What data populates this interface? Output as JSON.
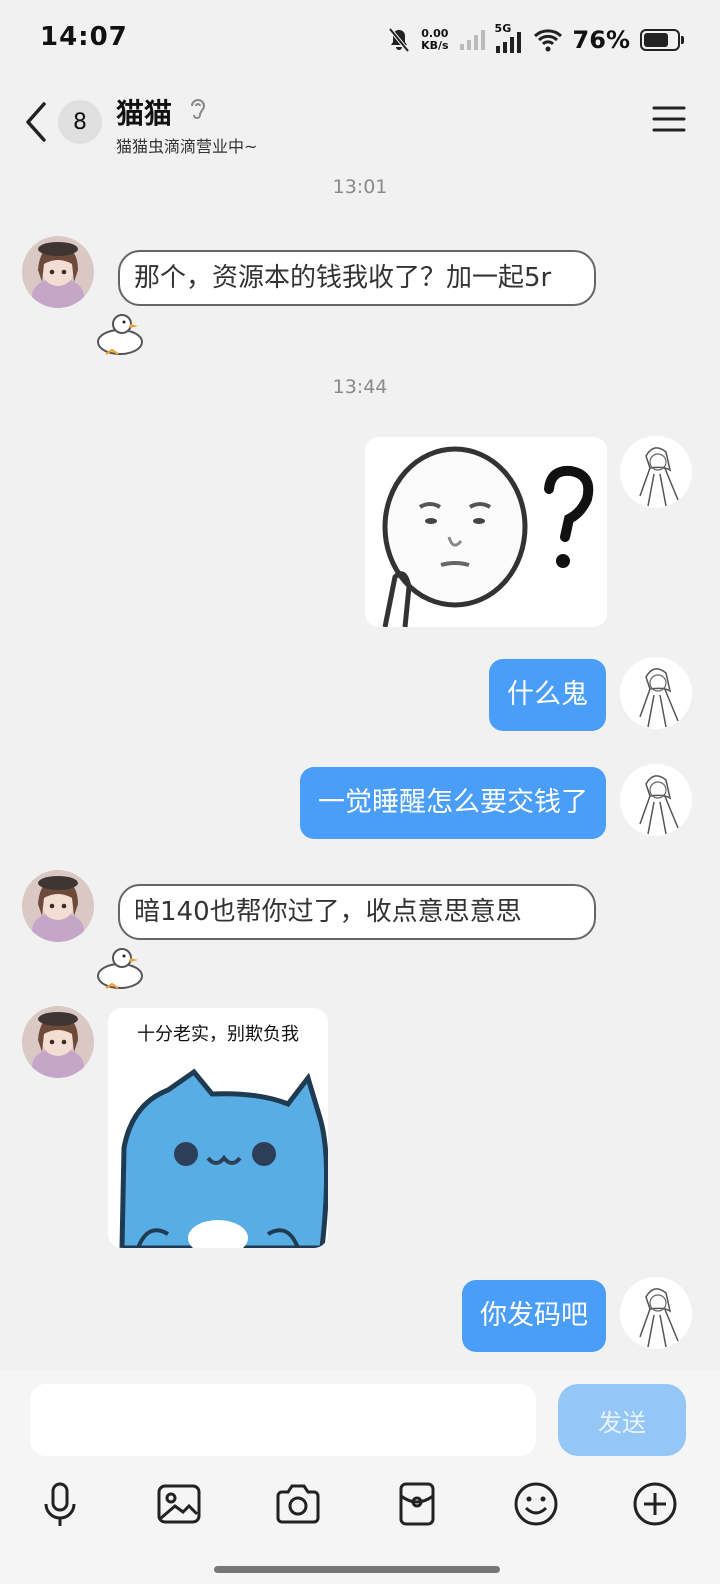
{
  "status": {
    "time": "14:07",
    "net_speed_value": "0.00",
    "net_speed_unit": "KB/s",
    "network": "5G",
    "battery": "76%"
  },
  "header": {
    "unread_count": "8",
    "title": "猫猫",
    "subtitle": "猫猫虫滴滴营业中~"
  },
  "messages": [
    {
      "type": "timestamp",
      "text": "13:01"
    },
    {
      "type": "text",
      "side": "left",
      "text": "那个，资源本的钱我收了？加一起5r"
    },
    {
      "type": "timestamp",
      "text": "13:44"
    },
    {
      "type": "sticker",
      "side": "right",
      "description": "?"
    },
    {
      "type": "text",
      "side": "right",
      "text": "什么鬼"
    },
    {
      "type": "text",
      "side": "right",
      "text": "一觉睡醒怎么要交钱了"
    },
    {
      "type": "text",
      "side": "left",
      "text": "暗140也帮你过了，收点意思意思"
    },
    {
      "type": "sticker",
      "side": "left",
      "caption": "十分老实，别欺负我"
    },
    {
      "type": "text",
      "side": "right",
      "text": "你发码吧"
    }
  ],
  "composer": {
    "send_label": "发送",
    "placeholder": ""
  },
  "toolbar": {
    "icons": [
      "microphone-icon",
      "image-icon",
      "camera-icon",
      "red-packet-icon",
      "emoji-icon",
      "plus-icon"
    ]
  },
  "colors": {
    "bubble_blue": "#4a9ef7",
    "send_disabled": "#94c6f6",
    "background": "#f1f1f1"
  }
}
